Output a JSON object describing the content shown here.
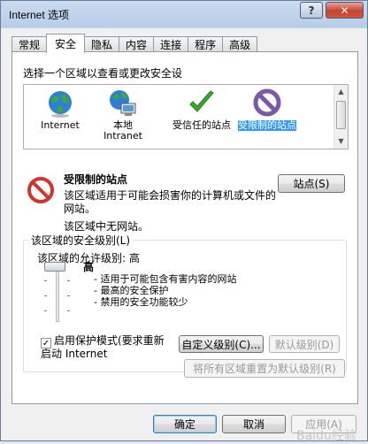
{
  "window": {
    "title": "Internet 选项",
    "help_label": "?",
    "close_label": "✕"
  },
  "tabs": [
    {
      "label": "常规"
    },
    {
      "label": "安全"
    },
    {
      "label": "隐私"
    },
    {
      "label": "内容"
    },
    {
      "label": "连接"
    },
    {
      "label": "程序"
    },
    {
      "label": "高级"
    }
  ],
  "security": {
    "zone_prompt": "选择一个区域以查看或更改安全设",
    "zones": [
      {
        "label": "Internet",
        "icon": "globe-icon"
      },
      {
        "label": "本地 Intranet",
        "icon": "intranet-icon"
      },
      {
        "label": "受信任的站点",
        "icon": "checkmark-icon"
      },
      {
        "label": "受限制的站点",
        "icon": "restricted-icon"
      }
    ],
    "selected_zone": {
      "title": "受限制的站点",
      "description": "该区域适用于可能会损害你的计算机或文件的网站。",
      "no_sites": "该区域中无网站。",
      "sites_button": "站点(S)"
    },
    "level_group": {
      "legend": "该区域的安全级别(L)",
      "allowed_label": "该区域的允许级别: 高",
      "level_name": "高",
      "level_items": [
        "- 适用于可能包含有害内容的网站",
        "- 最高的安全保护",
        "- 禁用的安全功能较少"
      ],
      "protected_mode_label": "启用保护模式(要求重新启动 Internet",
      "protected_mode_checked": true,
      "custom_level_button": "自定义级别(C)...",
      "default_level_button": "默认级别(D)"
    },
    "reset_all_button": "将所有区域重置为默认级别(R)"
  },
  "footer": {
    "ok": "确定",
    "cancel": "取消",
    "apply": "应用(A)"
  },
  "watermark": "Baidu经验"
}
